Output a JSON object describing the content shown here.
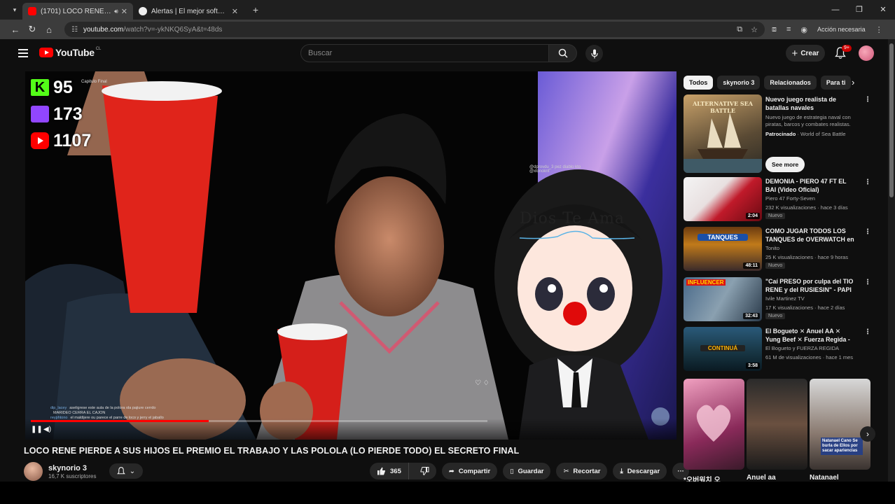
{
  "browser": {
    "tabs": [
      {
        "title": "(1701) LOCO RENE PIERDI",
        "active": true,
        "audio": true
      },
      {
        "title": "Alertas | El mejor software para",
        "active": false
      }
    ],
    "url_host": "youtube.com",
    "url_path": "/watch?v=-ykNKQ6SyA&t=48ds",
    "profile_text": "Acción necesaria"
  },
  "masthead": {
    "logo": "YouTube",
    "country": "CL",
    "search_placeholder": "Buscar",
    "create_label": "Crear",
    "notifications_badge": "9+"
  },
  "player": {
    "overlay_stats": [
      {
        "platform": "kick",
        "value": "95"
      },
      {
        "platform": "twitch",
        "value": "173"
      },
      {
        "platform": "youtube",
        "value": "1107"
      }
    ],
    "overlay_top_text": "Capitulo Final",
    "handle_text": "@dprovdu_3  pez diablo kto",
    "handle_text2": "@xlonoknt",
    "vtuber_sign": "Dios Te Ama",
    "chat_lines": [
      {
        "name": "dip_lacey",
        "text": "aseligrese este aula de la polora ola pajiure cerrdo"
      },
      {
        "name": "",
        "text": "MARIDEO CERRA EL CAJON"
      },
      {
        "name": "reyphtono",
        "text": "el maldijere ou parece el parre de loco y jerry el jaballo"
      }
    ],
    "progress": 0.39
  },
  "video": {
    "title": "LOCO RENE PIERDE A SUS HIJOS EL PREMIO EL TRABAJO Y LAS POLOLA (LO PIERDE TODO) EL SECRETO FINAL",
    "channel": "skynorio 3",
    "subscribers": "16,7 K suscriptores",
    "likes": "365",
    "share": "Compartir",
    "save": "Guardar",
    "clip": "Recortar",
    "download": "Descargar"
  },
  "sidebar": {
    "chips": [
      "Todos",
      "skynorio 3",
      "Relacionados",
      "Para ti"
    ],
    "ad": {
      "thumb_text": "ALTERNATIVE SEA BATTLE",
      "title": "Nuevo juego realista de batallas navales",
      "desc": "Nuevo juego de estrategia naval con piratas, barcos y combates realistas.",
      "sponsored": "Patrocinado",
      "advertiser": "World of Sea Battle",
      "cta": "See more"
    },
    "recs": [
      {
        "title": "DEMONIA - PIERO 47 FT EL BAI (Video Oficial)",
        "channel": "Piero 47 Forty-Seven",
        "meta": "232 K visualizaciones · hace 3 días",
        "badge": "Nuevo",
        "duration": "2:04"
      },
      {
        "title": "COMO JUGAR TODOS LOS TANQUES de OVERWATCH en ...",
        "channel": "Tonito",
        "meta": "25 K visualizaciones · hace 9 horas",
        "badge": "Nuevo",
        "duration": "48:11",
        "thumb_text": "TANQUES"
      },
      {
        "title": "\"Caí PRESO por culpa del TIO RENE y del RUSIESIN\" - PAPI ...",
        "channel": "Ivile Martinez TV",
        "meta": "17 K visualizaciones · hace 2 días",
        "badge": "Nuevo",
        "duration": "32:43",
        "thumb_text": "INFLUENCER"
      },
      {
        "title": "El Bogueto ✕ Anuel AA ✕ Yung Beef ✕ Fuerza Regida - ...",
        "channel": "El Bogueto y FUERZA REGIDA",
        "meta": "61 M de visualizaciones · hace 1 mes",
        "badge": "",
        "duration": "3:58",
        "thumb_text": "CONTINUÁ"
      }
    ],
    "shorts": [
      {
        "label": "*오버워치 오"
      },
      {
        "label": "Anuel aa"
      },
      {
        "label": "Natanael",
        "overlay": "Natanael Cano Se burla de Ellos por sacar apariencias"
      }
    ]
  },
  "colors": {
    "accent": "#ff0000",
    "kick": "#53fc18",
    "twitch": "#9146ff",
    "background": "#0f0f0f"
  }
}
